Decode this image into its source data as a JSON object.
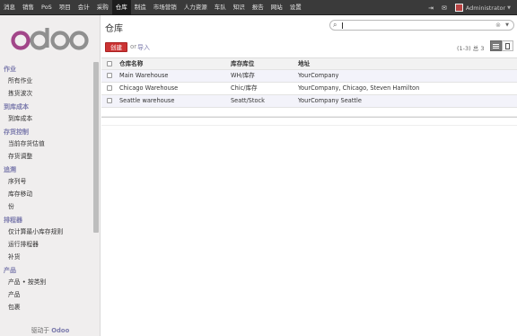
{
  "topbar": {
    "menu": [
      "消息",
      "销售",
      "PoS",
      "项目",
      "会计",
      "采购",
      "仓库",
      "制造",
      "市场营销",
      "人力资源",
      "车队",
      "知识",
      "报告",
      "网站",
      "设置"
    ],
    "active_menu": "仓库",
    "user": "Administrator"
  },
  "sidebar": {
    "sections": [
      {
        "title": "作业",
        "items": [
          "所有作业",
          "拣货波次"
        ]
      },
      {
        "title": "到库成本",
        "items": [
          "到库成本"
        ]
      },
      {
        "title": "存货控制",
        "items": [
          "当前存货估值",
          "存货调整"
        ]
      },
      {
        "title": "追溯",
        "items": [
          "序列号",
          "库存移动",
          "份"
        ]
      },
      {
        "title": "排程器",
        "items": [
          "仅计算最小库存规则",
          "运行排程器",
          "补货"
        ]
      },
      {
        "title": "产品",
        "items": [
          "产品 • 按类别",
          "产品",
          "包裹"
        ]
      }
    ],
    "powered_prefix": "驱动于",
    "powered_brand": "Odoo"
  },
  "content": {
    "title": "仓库",
    "create_label": "创建",
    "or_label": "or",
    "import_label": "导入",
    "pager": "(1-3) 总 3",
    "columns": [
      "仓库名称",
      "库存库位",
      "地址"
    ],
    "rows": [
      {
        "name": "Main Warehouse",
        "location": "WH/库存",
        "address": "YourCompany"
      },
      {
        "name": "Chicago Warehouse",
        "location": "Chic/库存",
        "address": "YourCompany, Chicago, Steven Hamilton"
      },
      {
        "name": "Seattle warehouse",
        "location": "Seatt/Stock",
        "address": "YourCompany Seattle"
      }
    ]
  },
  "colors": {
    "topbar_bg": "#3a3a3a",
    "brand": "#7c7bad",
    "create_button": "#cc3333",
    "sidebar_bg": "#f0eeee"
  }
}
